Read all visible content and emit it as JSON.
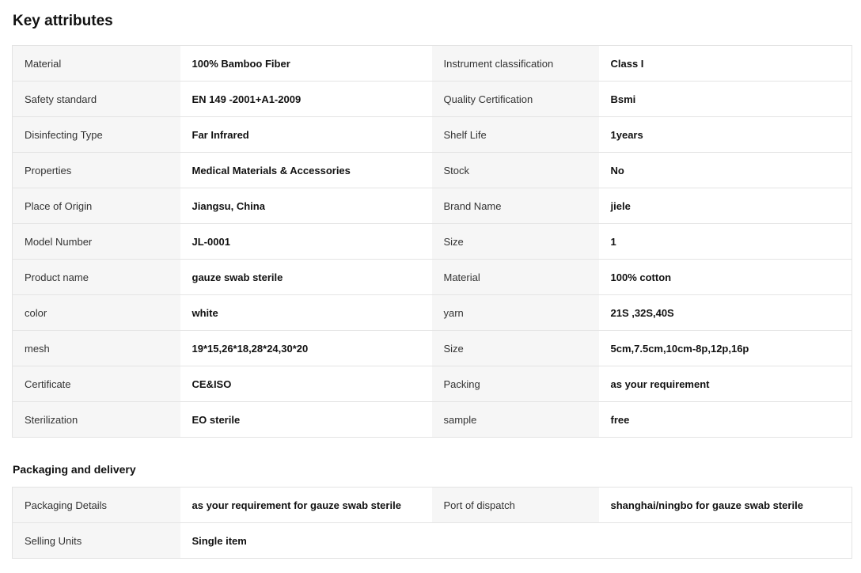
{
  "key_attributes": {
    "title": "Key attributes",
    "rows": [
      [
        {
          "label": "Material",
          "value": "100% Bamboo Fiber"
        },
        {
          "label": "Instrument classification",
          "value": "Class I"
        }
      ],
      [
        {
          "label": "Safety standard",
          "value": "EN 149 -2001+A1-2009"
        },
        {
          "label": "Quality Certification",
          "value": "Bsmi"
        }
      ],
      [
        {
          "label": "Disinfecting Type",
          "value": "Far Infrared"
        },
        {
          "label": "Shelf Life",
          "value": "1years"
        }
      ],
      [
        {
          "label": "Properties",
          "value": "Medical Materials & Accessories"
        },
        {
          "label": "Stock",
          "value": "No"
        }
      ],
      [
        {
          "label": "Place of Origin",
          "value": "Jiangsu, China"
        },
        {
          "label": "Brand Name",
          "value": "jiele"
        }
      ],
      [
        {
          "label": "Model Number",
          "value": "JL-0001"
        },
        {
          "label": "Size",
          "value": "1"
        }
      ],
      [
        {
          "label": "Product name",
          "value": "gauze swab sterile"
        },
        {
          "label": "Material",
          "value": "100% cotton"
        }
      ],
      [
        {
          "label": "color",
          "value": "white"
        },
        {
          "label": "yarn",
          "value": "21S ,32S,40S"
        }
      ],
      [
        {
          "label": "mesh",
          "value": "19*15,26*18,28*24,30*20"
        },
        {
          "label": "Size",
          "value": "5cm,7.5cm,10cm-8p,12p,16p"
        }
      ],
      [
        {
          "label": "Certificate",
          "value": "CE&ISO"
        },
        {
          "label": "Packing",
          "value": "as your requirement"
        }
      ],
      [
        {
          "label": "Sterilization",
          "value": "EO sterile"
        },
        {
          "label": "sample",
          "value": "free"
        }
      ]
    ]
  },
  "packaging": {
    "title": "Packaging and delivery",
    "rows": [
      [
        {
          "label": "Packaging Details",
          "value": "as your requirement for gauze swab sterile"
        },
        {
          "label": "Port of dispatch",
          "value": "shanghai/ningbo for gauze swab sterile"
        }
      ],
      [
        {
          "label": "Selling Units",
          "value": "Single item"
        },
        {
          "label": "",
          "value": ""
        }
      ]
    ]
  }
}
